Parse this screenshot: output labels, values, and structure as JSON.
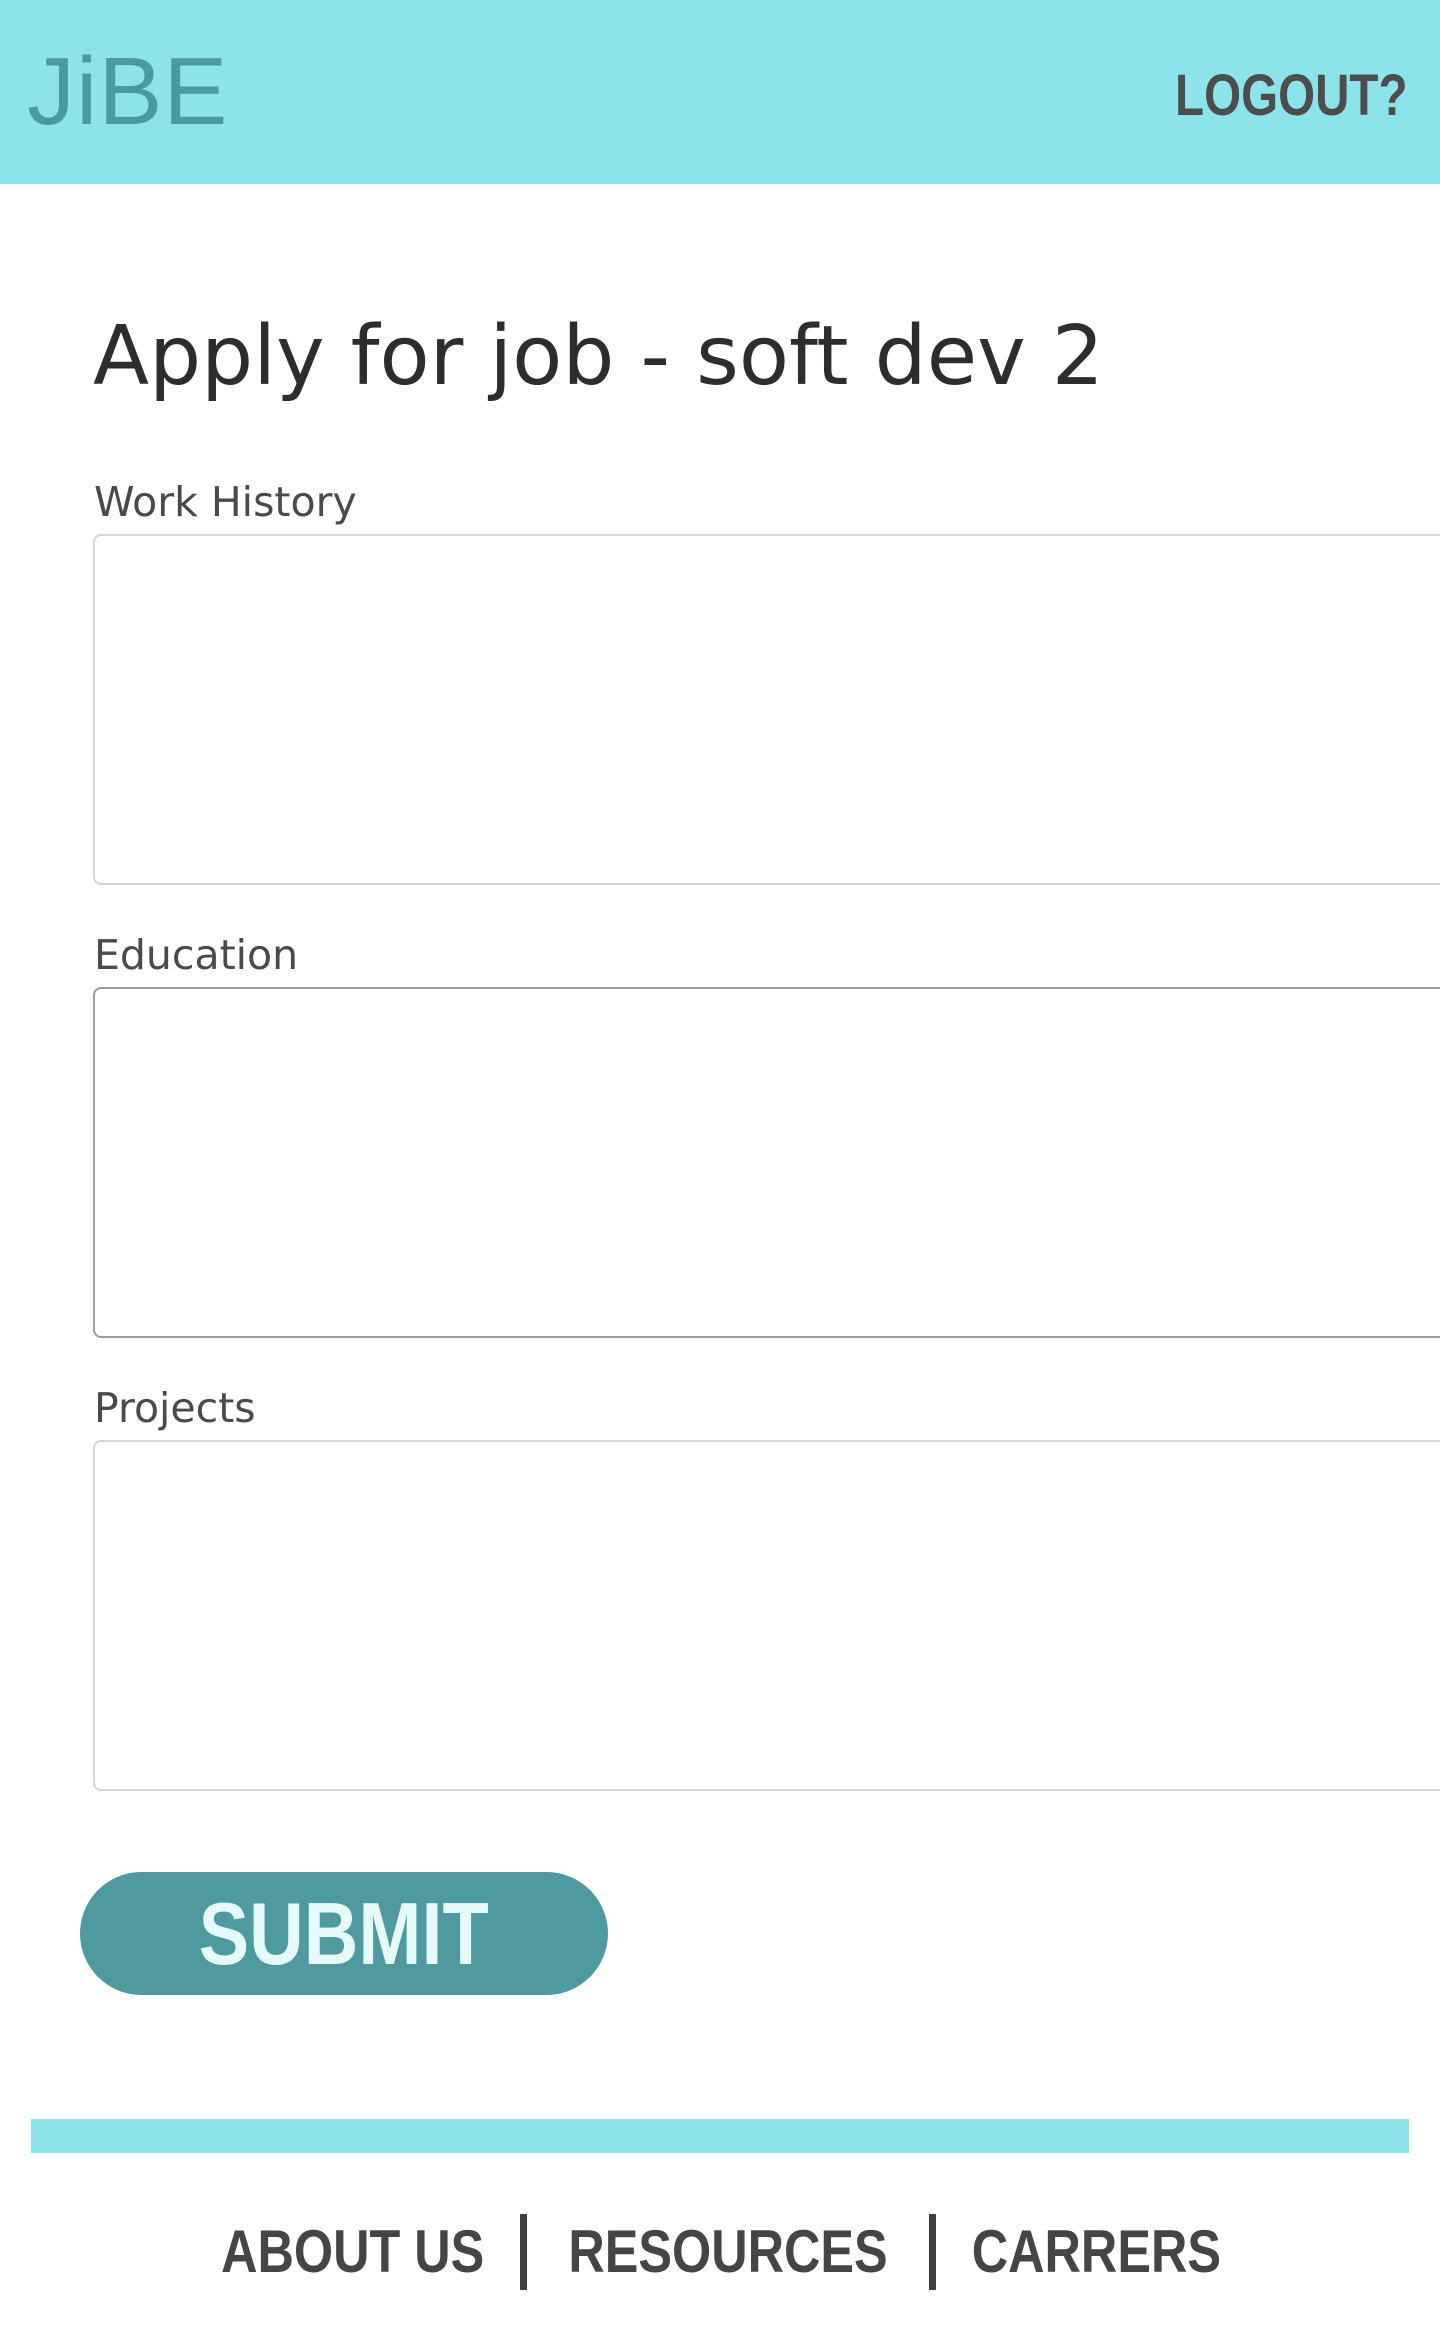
{
  "header": {
    "logo": "JiBE",
    "logout_label": "LOGOUT?"
  },
  "form": {
    "title": "Apply for job - soft dev 2",
    "fields": [
      {
        "label": "Work History",
        "value": ""
      },
      {
        "label": "Education",
        "value": ""
      },
      {
        "label": "Projects",
        "value": ""
      }
    ],
    "submit_label": "SUBMIT"
  },
  "footer": {
    "links": [
      "ABOUT US",
      "RESOURCES",
      "CARRERS"
    ]
  },
  "colors": {
    "header_bg": "#8ce4ea",
    "accent": "#4e9a9e",
    "text": "#2d2d2d"
  }
}
